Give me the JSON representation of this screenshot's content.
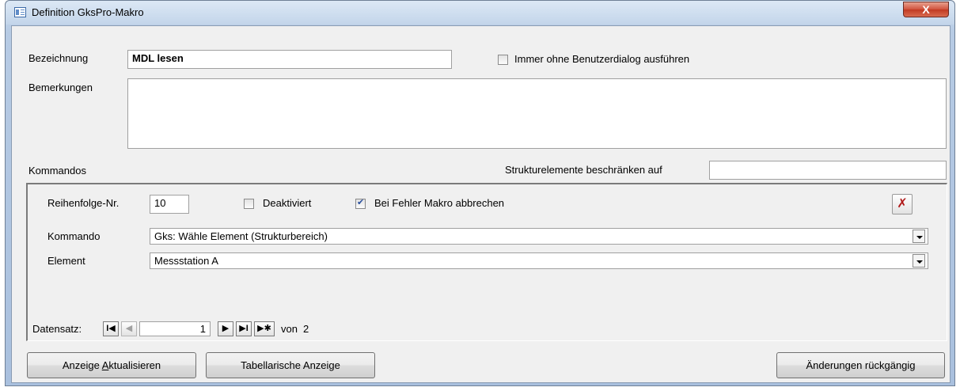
{
  "window": {
    "title": "Definition GksPro-Makro",
    "close_label": "X"
  },
  "header": {
    "bezeichnung_label": "Bezeichnung",
    "bezeichnung_value": "MDL lesen",
    "immer_ohne_label": "Immer ohne Benutzerdialog ausführen",
    "immer_ohne_checked": false,
    "bemerkungen_label": "Bemerkungen",
    "bemerkungen_value": "",
    "kommandos_label": "Kommandos",
    "struktur_label": "Strukturelemente beschränken auf",
    "struktur_value": ""
  },
  "subform": {
    "reihenfolge_label": "Reihenfolge-Nr.",
    "reihenfolge_value": "10",
    "deaktiviert_label": "Deaktiviert",
    "deaktiviert_checked": false,
    "bei_fehler_label": "Bei Fehler Makro abbrechen",
    "bei_fehler_checked": true,
    "kommando_label": "Kommando",
    "kommando_value": "Gks: Wähle Element (Strukturbereich)",
    "element_label": "Element",
    "element_value": "Messstation A",
    "delete_icon": "delete-record-icon"
  },
  "navigation": {
    "label": "Datensatz:",
    "current": "1",
    "of_label": "von",
    "total": "2",
    "first_glyph": "I◀",
    "prev_glyph": "◀",
    "next_glyph": "▶",
    "last_glyph": "▶I",
    "new_glyph": "▶✱"
  },
  "buttons": {
    "refresh_pre": "Anzeige ",
    "refresh_accel": "A",
    "refresh_post": "ktualisieren",
    "table_view": "Tabellarische Anzeige",
    "undo": "Änderungen rückgängig"
  }
}
